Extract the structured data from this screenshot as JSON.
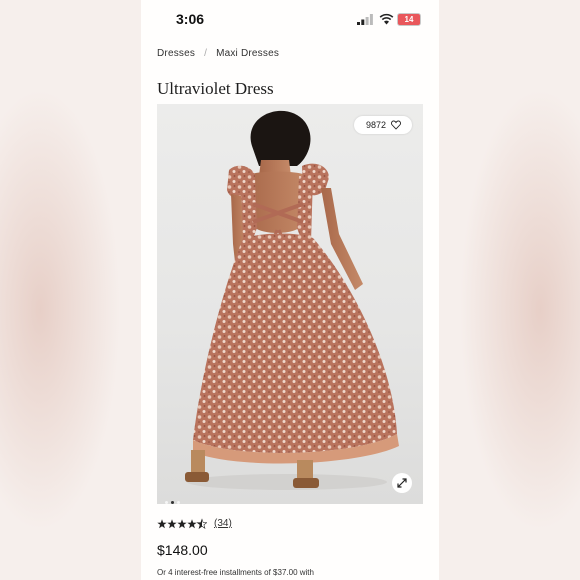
{
  "status_bar": {
    "time": "3:06",
    "battery": "14",
    "battery_color": "#e9575b"
  },
  "breadcrumb": {
    "items": [
      "Dresses",
      "Maxi Dresses"
    ]
  },
  "product": {
    "title": "Ultraviolet Dress",
    "favorites_count": "9872",
    "rating": 4.5,
    "reviews_count": "(34)",
    "price": "$148.00",
    "installments_text": "Or 4 interest-free installments of $37.00 with"
  },
  "gallery": {
    "dots": 3,
    "active_index": 1
  },
  "icons": [
    "signal-icon",
    "wifi-icon",
    "heart-icon",
    "expand-icon",
    "star-icon"
  ]
}
